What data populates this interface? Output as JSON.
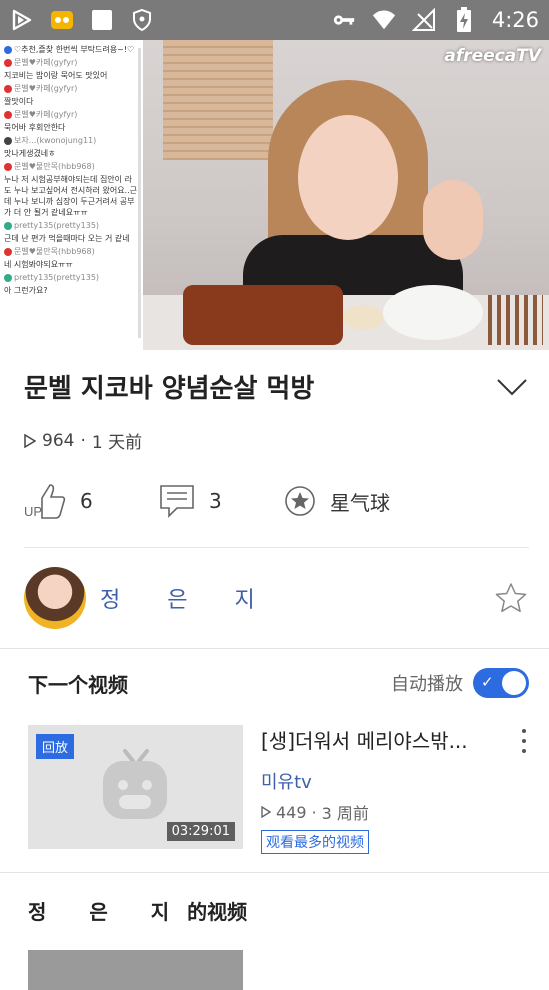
{
  "status_bar": {
    "time": "4:26",
    "left_icons": [
      "play-store-icon",
      "afreeca-app-icon",
      "square-icon",
      "shield-icon"
    ],
    "right_icons": [
      "key-icon",
      "wifi-icon",
      "no-signal-icon",
      "battery-charging-icon"
    ]
  },
  "video": {
    "logo": "afreecaTV",
    "chat": [
      {
        "user": "",
        "text": "♡추천,즐찾 한번씩 부탁드려용~!♡"
      },
      {
        "user": "문벨♥카페(gyfyr)",
        "text": "지코비는 밥이랑 묵어도 맛있어"
      },
      {
        "user": "문벨♥카페(gyfyr)",
        "text": "짤맛이다"
      },
      {
        "user": "문벨♥카페(gyfyr)",
        "text": "묵어바 후회안한다"
      },
      {
        "user": "보자...(kwonojung11)",
        "text": "맛나게생겼네ㅎ"
      },
      {
        "user": "문벨♥물만목(hbb968)",
        "text": "누나 저 시험공부해야되는데 집안이 라도 누나 보고싶어서 전시하러 왔어요..근데 누나 보니까 심장이 두근거려서 공부가 더 안 될거 같네요ㅠㅠ"
      },
      {
        "user": "pretty135(pretty135)",
        "text": "근데 난 편가 먹을때마다 오는 거 같네"
      },
      {
        "user": "문벨♥물만목(hbb968)",
        "text": "네 시험봐야되요ㅠㅠ"
      },
      {
        "user": "pretty135(pretty135)",
        "text": "아 그런가요?"
      }
    ]
  },
  "title": "문벨 지코바 양념순살 먹방",
  "meta": {
    "views": "964",
    "time": "1 天前"
  },
  "actions": {
    "like_count": "6",
    "comment_count": "3",
    "balloon_label": "星气球"
  },
  "channel": {
    "name": "정 은 지"
  },
  "next": {
    "heading": "下一个视频",
    "autoplay_label": "自动播放",
    "autoplay_on": true
  },
  "card": {
    "badge": "回放",
    "duration": "03:29:01",
    "title": "[생]더워서 메리야스밖...",
    "channel": "미유tv",
    "views": "449",
    "time": "3 周前",
    "tag": "观看最多的视频"
  },
  "their_videos": {
    "name": "정 은 지",
    "suffix": "的视频"
  },
  "colors": {
    "accent": "#2c6be0",
    "channel_link": "#3f5fa8"
  }
}
